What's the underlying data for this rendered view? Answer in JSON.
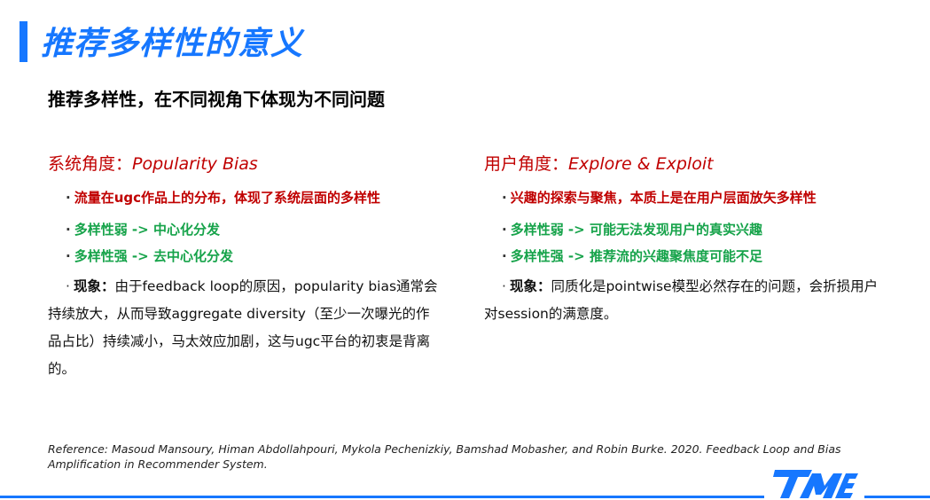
{
  "title": "推荐多样性的意义",
  "subtitle": "推荐多样性，在不同视角下体现为不同问题",
  "left": {
    "heading_cn": "系统角度：",
    "heading_en": "Popularity Bias",
    "bullet1": "流量在ugc作品上的分布，体现了系统层面的多样性",
    "bullet2": "多样性弱 -> 中心化分发",
    "bullet3": "多样性强 -> 去中心化分发",
    "phenomenon_key": "现象：",
    "phenomenon_text": "由于feedback loop的原因，popularity bias通常会持续放大，从而导致aggregate diversity（至少一次曝光的作品占比）持续减小，马太效应加剧，这与ugc平台的初衷是背离的。"
  },
  "right": {
    "heading_cn": "用户角度：",
    "heading_en": "Explore & Exploit",
    "bullet1": "兴趣的探索与聚焦，本质上是在用户层面放矢多样性",
    "bullet2": "多样性弱 -> 可能无法发现用户的真实兴趣",
    "bullet3": "多样性强 -> 推荐流的兴趣聚焦度可能不足",
    "phenomenon_key": "现象：",
    "phenomenon_text": "同质化是pointwise模型必然存在的问题，会折损用户对session的满意度。"
  },
  "bullet_dot": "·",
  "reference": "Reference: Masoud Mansoury, Himan Abdollahpouri, Mykola Pechenizkiy, Bamshad Mobasher, and Robin Burke. 2020. Feedback Loop and Bias Amplification in Recommender System.",
  "colors": {
    "accent": "#1677ff",
    "red": "#c00000",
    "green": "#16a34a"
  },
  "logo_icon": "tme-logo-icon"
}
